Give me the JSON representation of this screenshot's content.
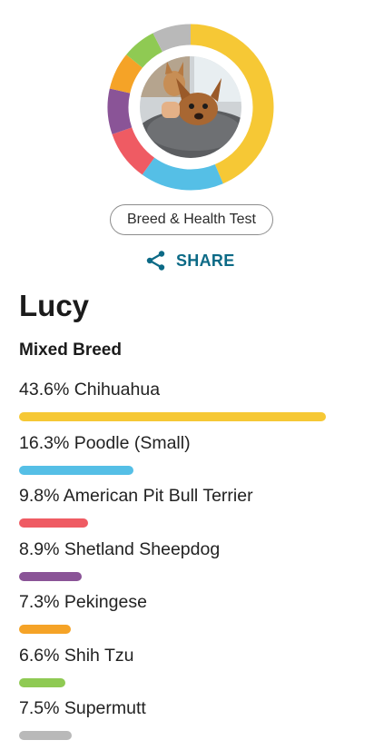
{
  "profile": {
    "test_label": "Breed & Health Test",
    "share_label": "SHARE",
    "dog_name": "Lucy",
    "breed_type": "Mixed Breed"
  },
  "breeds": [
    {
      "percent": 43.6,
      "label": "43.6% Chihuahua",
      "color": "#f6c835"
    },
    {
      "percent": 16.3,
      "label": "16.3% Poodle (Small)",
      "color": "#55bfe6"
    },
    {
      "percent": 9.8,
      "label": "9.8% American Pit Bull Terrier",
      "color": "#ef5b63"
    },
    {
      "percent": 8.9,
      "label": "8.9% Shetland Sheepdog",
      "color": "#8a5497"
    },
    {
      "percent": 7.3,
      "label": "7.3% Pekingese",
      "color": "#f5a327"
    },
    {
      "percent": 6.6,
      "label": "6.6% Shih Tzu",
      "color": "#8fca53"
    },
    {
      "percent": 7.5,
      "label": "7.5% Supermutt",
      "color": "#b9b9b9"
    }
  ]
}
